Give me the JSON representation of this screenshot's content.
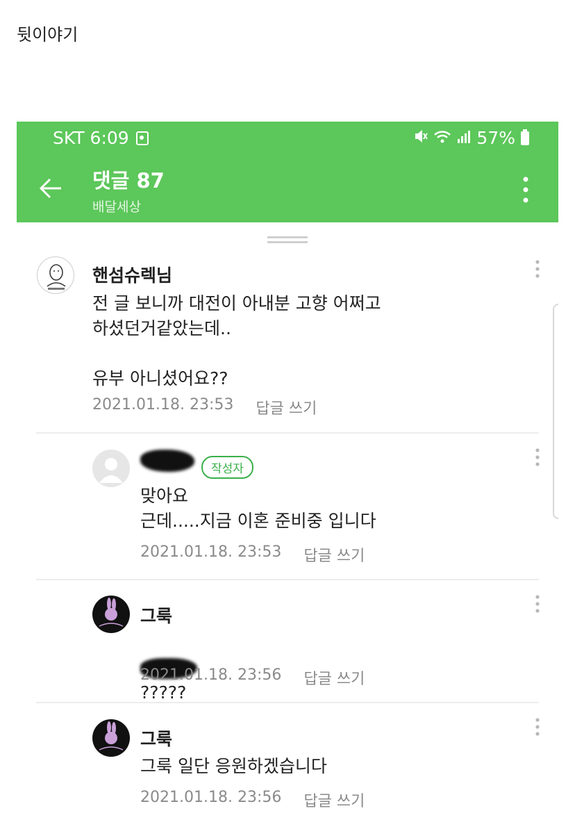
{
  "page_caption": "뒷이야기",
  "status": {
    "carrier_time": "SKT 6:09",
    "battery": "57%"
  },
  "appbar": {
    "title": "댓글 87",
    "subtitle": "배달세상"
  },
  "comments": [
    {
      "author": "핸섬슈렉님",
      "text": "전 글 보니까 대전이 아내분 고향 어쩌고\n하셨던거같았는데..\n\n유부 아니셨어요??",
      "timestamp": "2021.01.18. 23:53",
      "reply_label": "답글 쓰기"
    },
    {
      "author_badge": "작성자",
      "text": "맞아요\n근데.....지금 이혼 준비중 입니다",
      "timestamp": "2021.01.18. 23:53",
      "reply_label": "답글 쓰기"
    },
    {
      "author": "그룩",
      "text_suffix": "?????",
      "timestamp": "2021.01.18. 23:56",
      "reply_label": "답글 쓰기"
    },
    {
      "author": "그룩",
      "text": "그룩 일단 응원하겠습니다",
      "timestamp": "2021.01.18. 23:56",
      "reply_label": "답글 쓰기"
    }
  ],
  "colors": {
    "accent": "#5cc75a",
    "badge": "#3ab04a",
    "meta_text": "#8a8a8a"
  }
}
